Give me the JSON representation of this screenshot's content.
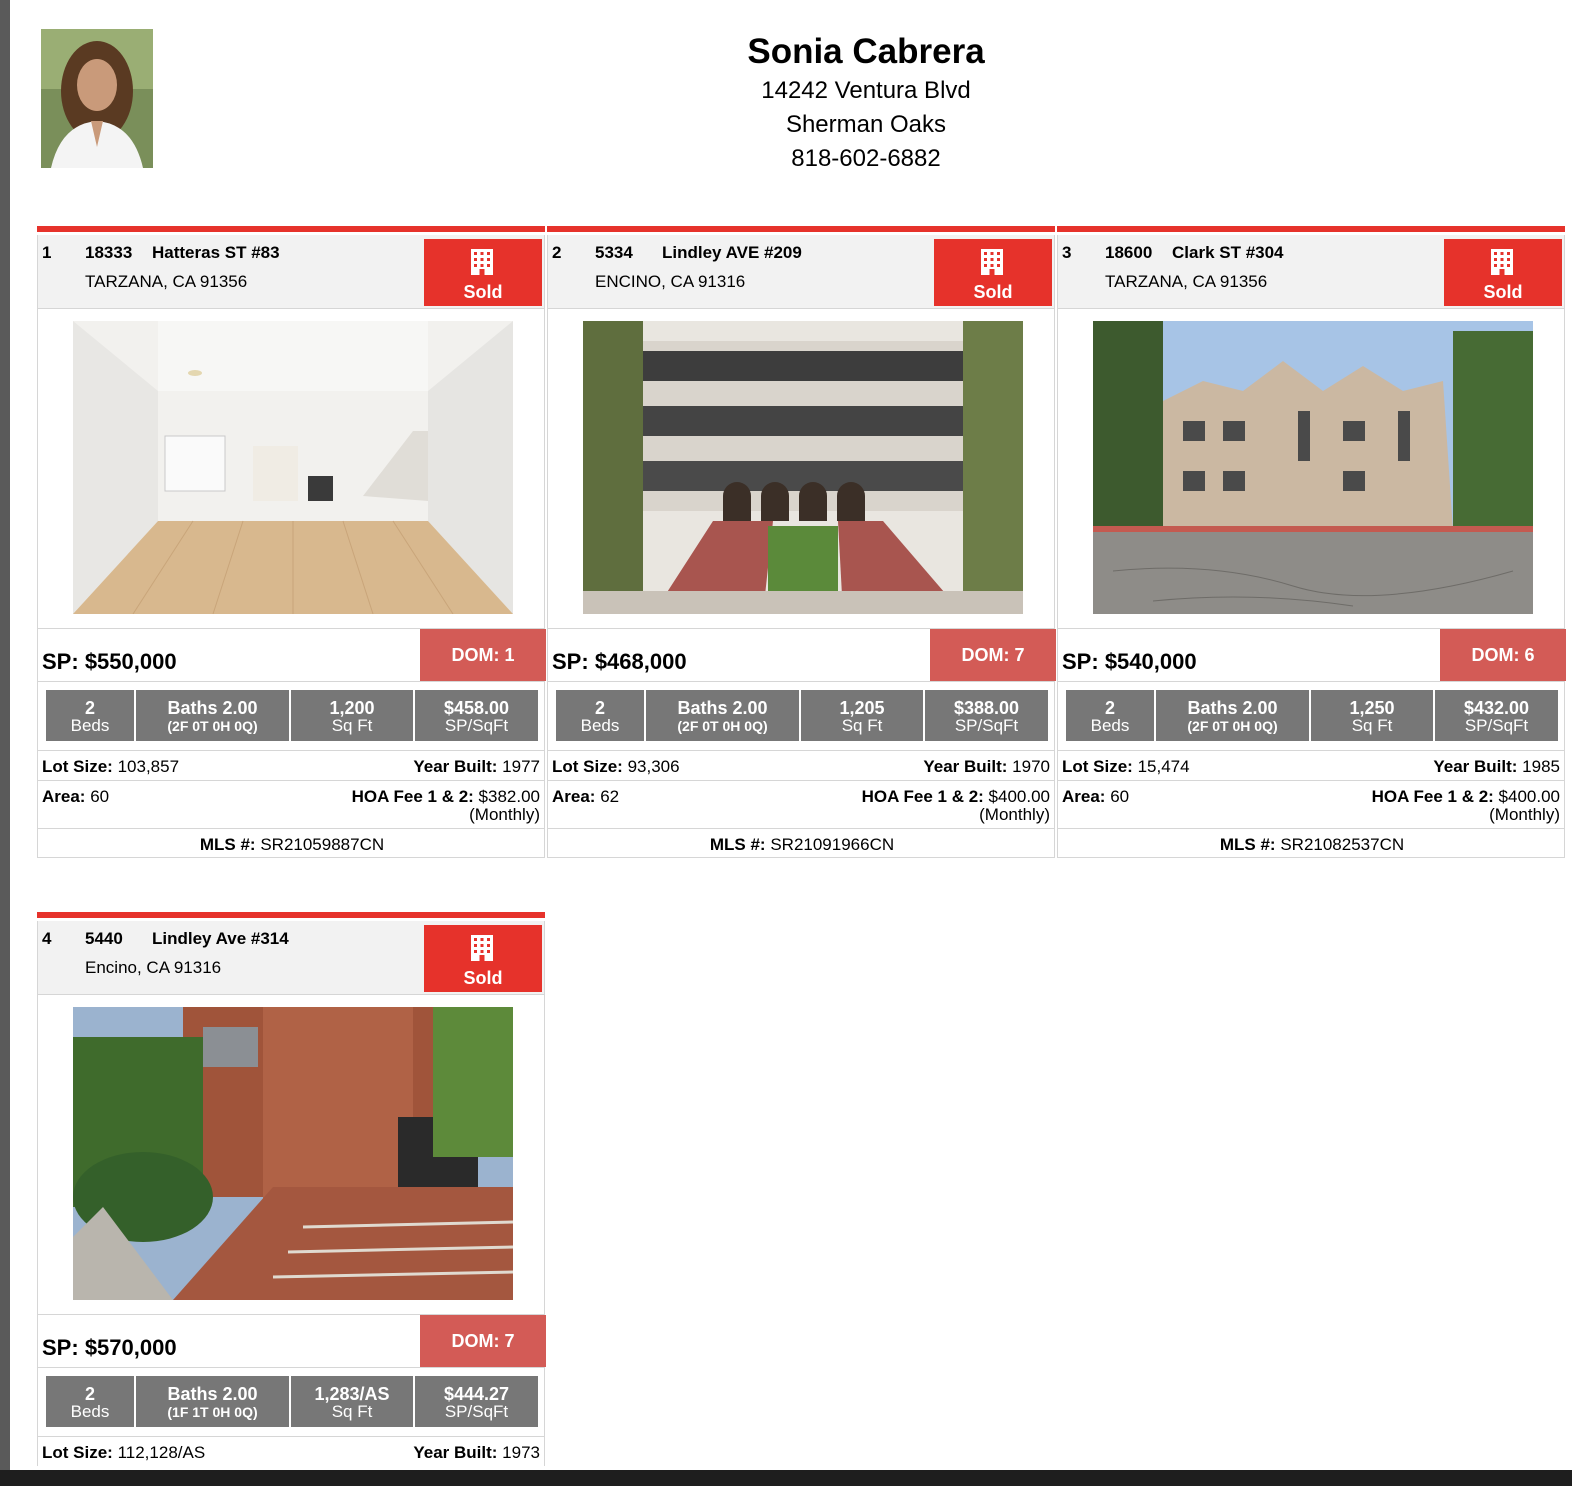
{
  "agent": {
    "name": "Sonia Cabrera",
    "address": "14242 Ventura Blvd",
    "city": "Sherman Oaks",
    "phone": "818-602-6882"
  },
  "labels": {
    "sp": "SP:",
    "dom": "DOM:",
    "beds": "Beds",
    "sqft": "Sq Ft",
    "sp_sqft": "SP/SqFt",
    "lot_size": "Lot Size:",
    "year_built": "Year Built:",
    "area": "Area:",
    "hoa": "HOA Fee 1 & 2:",
    "mls": "MLS #:",
    "status": "Sold"
  },
  "listings": [
    {
      "index": "1",
      "street_number": "18333",
      "street_name": "Hatteras ST #83",
      "city_line": "TARZANA, CA 91356",
      "price": "$550,000",
      "dom": "1",
      "beds": "2",
      "baths": "Baths 2.00",
      "baths_detail": "(2F 0T 0H 0Q)",
      "sqft": "1,200",
      "sp_sqft": "$458.00",
      "lot_size": "103,857",
      "year_built": "1977",
      "area": "60",
      "hoa_fee": "$382.00",
      "hoa_period": "(Monthly)",
      "mls": "SR21059887CN"
    },
    {
      "index": "2",
      "street_number": "5334",
      "street_name": "Lindley AVE #209",
      "city_line": "ENCINO, CA 91316",
      "price": "$468,000",
      "dom": "7",
      "beds": "2",
      "baths": "Baths 2.00",
      "baths_detail": "(2F 0T 0H 0Q)",
      "sqft": "1,205",
      "sp_sqft": "$388.00",
      "lot_size": "93,306",
      "year_built": "1970",
      "area": "62",
      "hoa_fee": "$400.00",
      "hoa_period": "(Monthly)",
      "mls": "SR21091966CN"
    },
    {
      "index": "3",
      "street_number": "18600",
      "street_name": "Clark ST #304",
      "city_line": "TARZANA, CA 91356",
      "price": "$540,000",
      "dom": "6",
      "beds": "2",
      "baths": "Baths 2.00",
      "baths_detail": "(2F 0T 0H 0Q)",
      "sqft": "1,250",
      "sp_sqft": "$432.00",
      "lot_size": "15,474",
      "year_built": "1985",
      "area": "60",
      "hoa_fee": "$400.00",
      "hoa_period": "(Monthly)",
      "mls": "SR21082537CN"
    },
    {
      "index": "4",
      "street_number": "5440",
      "street_name": "Lindley Ave #314",
      "city_line": "Encino, CA 91316",
      "price": "$570,000",
      "dom": "7",
      "beds": "2",
      "baths": "Baths 2.00",
      "baths_detail": "(1F 1T 0H 0Q)",
      "sqft": "1,283/AS",
      "sp_sqft": "$444.27",
      "lot_size": "112,128/AS",
      "year_built": "1973"
    }
  ],
  "colors": {
    "accent_red": "#e6322b",
    "dom_red": "#d35b56",
    "stat_gray": "#777777"
  },
  "icons": {
    "status": "building-icon"
  }
}
